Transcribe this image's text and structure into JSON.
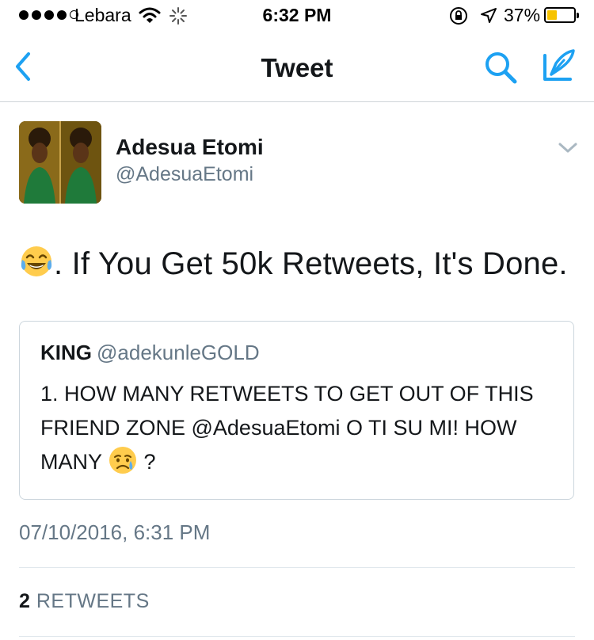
{
  "status_bar": {
    "carrier": "Lebara",
    "time": "6:32 PM",
    "battery": "37%",
    "battery_level": 0.37,
    "signal_bars": 4,
    "icons": [
      "wifi-icon",
      "activity-spinner-icon",
      "rotation-lock-icon",
      "location-arrow-icon",
      "battery-icon"
    ]
  },
  "nav": {
    "title": "Tweet",
    "icons": [
      "back-chevron-icon",
      "search-icon",
      "compose-icon"
    ],
    "accent": "#1da1f2"
  },
  "tweet": {
    "author_name": "Adesua Etomi",
    "author_handle": "@AdesuaEtomi",
    "text": ". If You Get 50k Retweets, It's Done.",
    "leading_emoji": "tears-of-joy-emoji",
    "timestamp": "07/10/2016, 6:31 PM",
    "retweet_count": "2",
    "retweet_label": "RETWEETS"
  },
  "quoted_tweet": {
    "author_name": "KING",
    "author_handle": "@adekunleGOLD",
    "text": "1. HOW MANY RETWEETS TO GET OUT OF THIS FRIEND ZONE @AdesuaEtomi O TI SU MI! HOW MANY",
    "trailing_emoji": "disappointed-relieved-emoji",
    "trailing_text": " ?"
  },
  "colors": {
    "text_primary": "#14171a",
    "text_secondary": "#657786",
    "divider": "#e1e8ed",
    "battery_fill": "#f7c300"
  }
}
